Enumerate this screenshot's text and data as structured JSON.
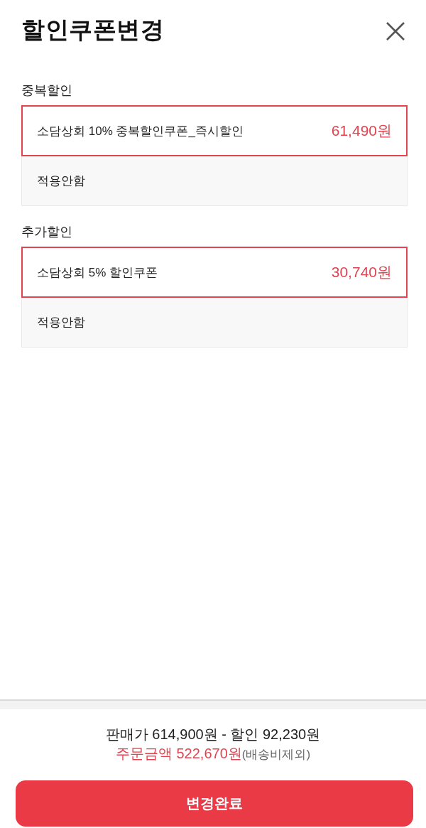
{
  "header": {
    "title": "할인쿠폰변경"
  },
  "sections": [
    {
      "label": "중복할인",
      "options": [
        {
          "name": "소담상회 10% 중복할인쿠폰_즉시할인",
          "amount": "61,490원",
          "selected": true
        },
        {
          "name": "적용안함",
          "selected": false
        }
      ]
    },
    {
      "label": "추가할인",
      "options": [
        {
          "name": "소담상회 5% 할인쿠폰",
          "amount": "30,740원",
          "selected": true
        },
        {
          "name": "적용안함",
          "selected": false
        }
      ]
    }
  ],
  "summary": {
    "price_line": "판매가 614,900원 - 할인 92,230원",
    "order_total": "주문금액 522,670원",
    "note": "(배송비제외)"
  },
  "buttons": [
    {
      "label": "변경완료"
    }
  ]
}
